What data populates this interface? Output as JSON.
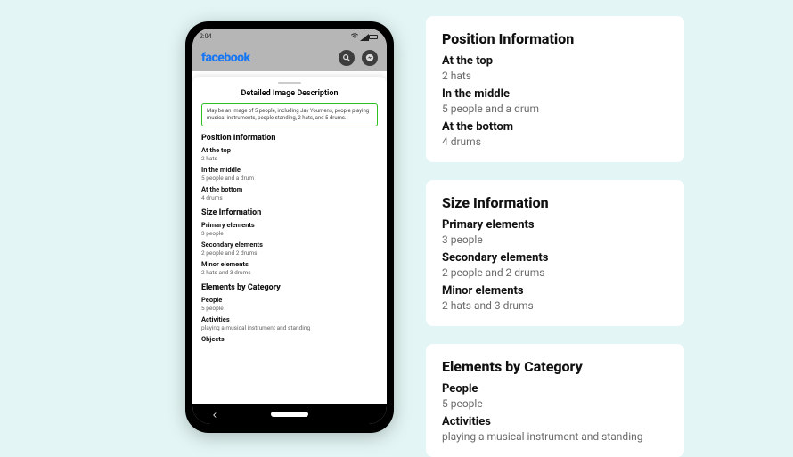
{
  "status": {
    "time": "2:04"
  },
  "app": {
    "logo": "facebook"
  },
  "icons": {
    "search": "search-icon",
    "messenger": "messenger-icon"
  },
  "sheet": {
    "title": "Detailed Image Description"
  },
  "desc": "May be an image of 5 people, including Jay Youmens, people playing musical instruments, people standing, 2 hats, and 5 drums.",
  "position": {
    "heading": "Position Information",
    "top": {
      "label": "At the top",
      "value": "2 hats"
    },
    "middle": {
      "label": "In the middle",
      "value": "5 people and a drum"
    },
    "bottom": {
      "label": "At the bottom",
      "value": "4 drums"
    }
  },
  "size": {
    "heading": "Size Information",
    "primary": {
      "label": "Primary elements",
      "value": "3 people"
    },
    "secondary": {
      "label": "Secondary elements",
      "value": "2 people and 2 drums"
    },
    "minor": {
      "label": "Minor elements",
      "value": "2 hats and 3 drums"
    }
  },
  "category": {
    "heading": "Elements by Category",
    "people": {
      "label": "People",
      "value": "5 people"
    },
    "activities": {
      "label": "Activities",
      "value": "playing a musical instrument and standing"
    },
    "objects": {
      "label": "Objects"
    }
  }
}
